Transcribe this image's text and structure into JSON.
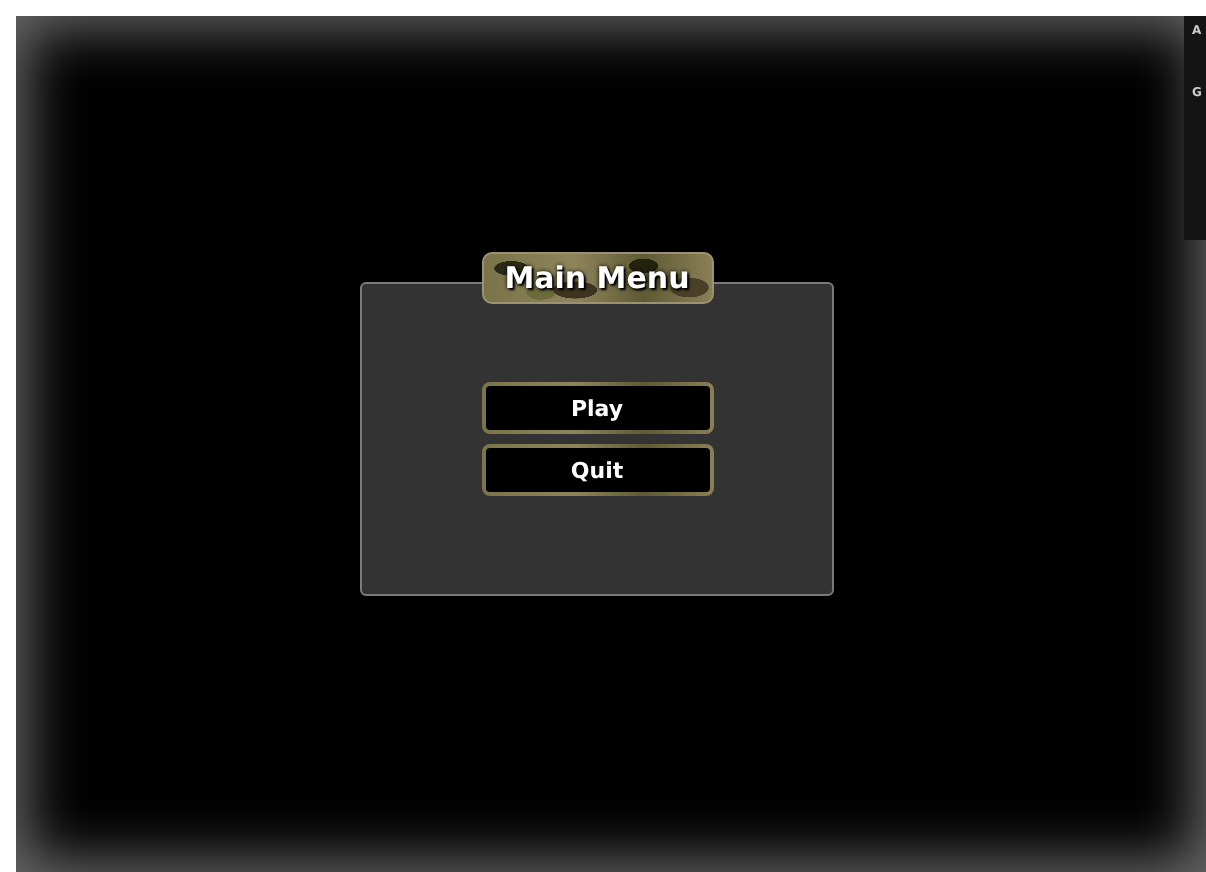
{
  "menu": {
    "title": "Main Menu",
    "buttons": [
      {
        "label": "Play"
      },
      {
        "label": "Quit"
      }
    ]
  },
  "side_panel": {
    "headings": [
      "A",
      "G"
    ]
  }
}
